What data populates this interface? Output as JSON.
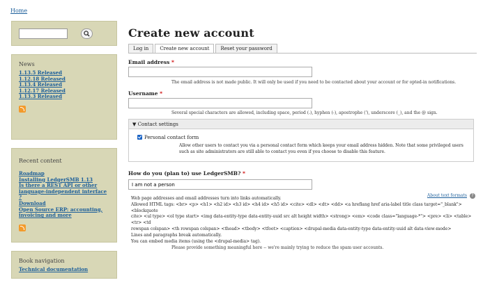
{
  "breadcrumb": {
    "home": "Home"
  },
  "search": {
    "placeholder": "",
    "button_icon": "search-icon"
  },
  "news": {
    "title": "News",
    "items": [
      "1.13.5 Released",
      "1.12.18 Released",
      "1.13.4 Released",
      "1.12.17 Released",
      "1.13.3 Released"
    ]
  },
  "recent": {
    "title": "Recent content",
    "items": [
      "Roadmap",
      "Installing LedgerSMB 1.13",
      "Is there a REST API or other language-independent interface ?",
      "Download",
      "Open Source ERP: accounting, invoicing and more"
    ]
  },
  "book": {
    "title": "Book navigation",
    "item": "Technical documentation"
  },
  "page": {
    "title": "Create new account"
  },
  "tabs": {
    "login": "Log in",
    "create": "Create new account",
    "reset": "Reset your password"
  },
  "email": {
    "label": "Email address",
    "required_mark": "*",
    "value": "",
    "description": "The email address is not made public. It will only be used if you need to be contacted about your account or for opted-in notifications."
  },
  "username": {
    "label": "Username",
    "required_mark": "*",
    "value": "",
    "description": "Several special characters are allowed, including space, period (.), hyphen (-), apostrophe ('), underscore (_), and the @ sign."
  },
  "contact": {
    "legend": "Contact settings",
    "checkbox_label": "Personal contact form",
    "checked": true,
    "description": "Allow other users to contact you via a personal contact form which keeps your email address hidden. Note that some privileged users such as site administrators are still able to contact you even if you choose to disable this feature."
  },
  "plan": {
    "label": "How do you (plan to) use LedgerSMB?",
    "required_mark": "*",
    "value": "I am not a person"
  },
  "formats": {
    "line1": "Web page addresses and email addresses turn into links automatically.",
    "line2": "Allowed HTML tags: <br> <p> <h1> <h2 id> <h3 id> <h4 id> <h5 id> <cite> <dl> <dt> <dd> <a hreflang href aria-label title class target=\"_blank\"> <blockquote",
    "line3": "cite> <ul type> <ol type start> <img data-entity-type data-entity-uuid src alt height width> <strong> <em> <code class=\"language-*\"> <pre> <li> <table> <tr> <td",
    "line4": "rowspan colspan> <th rowspan colspan> <thead> <tbody> <tfoot> <caption> <drupal-media data-entity-type data-entity-uuid alt data-view-mode>",
    "line5": "Lines and paragraphs break automatically.",
    "line6": "You can embed media items (using the <drupal-media> tag).",
    "about": "About text formats",
    "note": "Please provide something meaningful here -- we're mainly trying to reduce the spam user accounts."
  }
}
